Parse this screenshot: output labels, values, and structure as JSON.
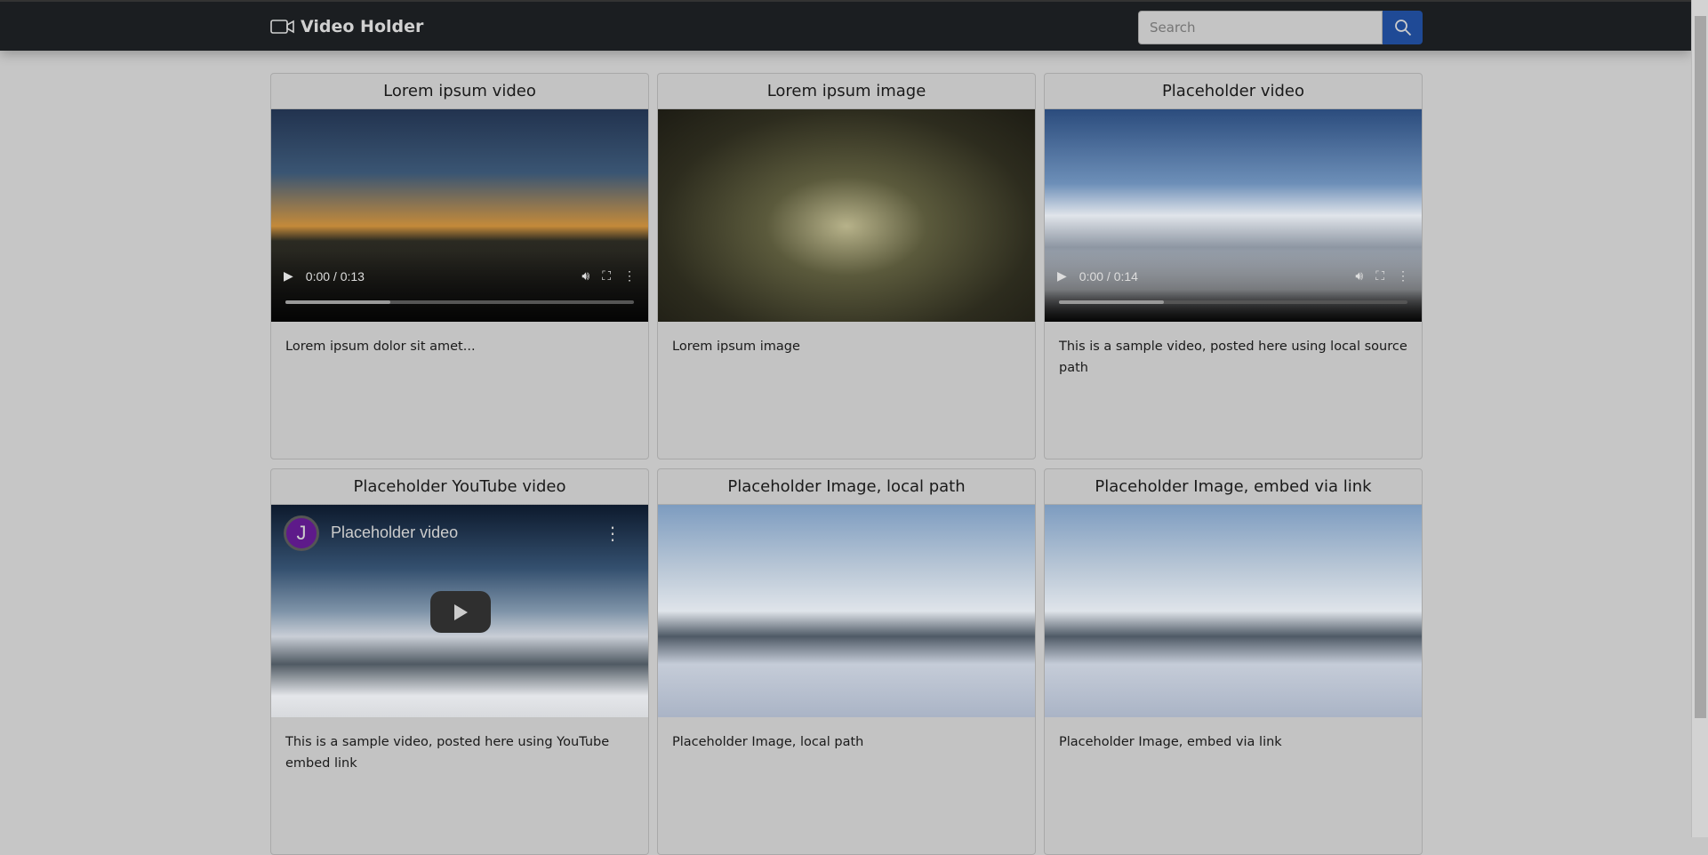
{
  "nav": {
    "brand": "Video Holder",
    "brand_icon": "video-camera-icon",
    "search_placeholder": "Search",
    "search_icon": "search-icon",
    "accent": "#1f4a96"
  },
  "cards": [
    {
      "title": "Lorem ipsum video",
      "type": "video",
      "time": "0:00 / 0:13",
      "progress": 0.3,
      "text": "Lorem ipsum dolor sit amet..."
    },
    {
      "title": "Lorem ipsum image",
      "type": "image",
      "text": "Lorem ipsum image"
    },
    {
      "title": "Placeholder video",
      "type": "video",
      "time": "0:00 / 0:14",
      "progress": 0.3,
      "text": "This is a sample video, posted here using local source path"
    },
    {
      "title": "Placeholder YouTube video",
      "type": "youtube",
      "yt_title": "Placeholder video",
      "avatar": "J",
      "text": "This is a sample video, posted here using YouTube embed link"
    },
    {
      "title": "Placeholder Image, local path",
      "type": "image",
      "text": "Placeholder Image, local path"
    },
    {
      "title": "Placeholder Image, embed via link",
      "type": "image",
      "text": "Placeholder Image, embed via link"
    }
  ]
}
